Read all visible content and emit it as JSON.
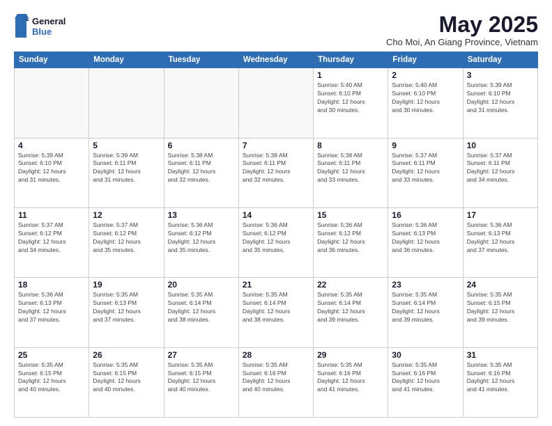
{
  "logo": {
    "line1": "General",
    "line2": "Blue"
  },
  "title": "May 2025",
  "subtitle": "Cho Moi, An Giang Province, Vietnam",
  "weekdays": [
    "Sunday",
    "Monday",
    "Tuesday",
    "Wednesday",
    "Thursday",
    "Friday",
    "Saturday"
  ],
  "weeks": [
    [
      {
        "day": "",
        "info": []
      },
      {
        "day": "",
        "info": []
      },
      {
        "day": "",
        "info": []
      },
      {
        "day": "",
        "info": []
      },
      {
        "day": "1",
        "info": [
          "Sunrise: 5:40 AM",
          "Sunset: 6:10 PM",
          "Daylight: 12 hours",
          "and 30 minutes."
        ]
      },
      {
        "day": "2",
        "info": [
          "Sunrise: 5:40 AM",
          "Sunset: 6:10 PM",
          "Daylight: 12 hours",
          "and 30 minutes."
        ]
      },
      {
        "day": "3",
        "info": [
          "Sunrise: 5:39 AM",
          "Sunset: 6:10 PM",
          "Daylight: 12 hours",
          "and 31 minutes."
        ]
      }
    ],
    [
      {
        "day": "4",
        "info": [
          "Sunrise: 5:39 AM",
          "Sunset: 6:10 PM",
          "Daylight: 12 hours",
          "and 31 minutes."
        ]
      },
      {
        "day": "5",
        "info": [
          "Sunrise: 5:39 AM",
          "Sunset: 6:11 PM",
          "Daylight: 12 hours",
          "and 31 minutes."
        ]
      },
      {
        "day": "6",
        "info": [
          "Sunrise: 5:38 AM",
          "Sunset: 6:11 PM",
          "Daylight: 12 hours",
          "and 32 minutes."
        ]
      },
      {
        "day": "7",
        "info": [
          "Sunrise: 5:38 AM",
          "Sunset: 6:11 PM",
          "Daylight: 12 hours",
          "and 32 minutes."
        ]
      },
      {
        "day": "8",
        "info": [
          "Sunrise: 5:38 AM",
          "Sunset: 6:11 PM",
          "Daylight: 12 hours",
          "and 33 minutes."
        ]
      },
      {
        "day": "9",
        "info": [
          "Sunrise: 5:37 AM",
          "Sunset: 6:11 PM",
          "Daylight: 12 hours",
          "and 33 minutes."
        ]
      },
      {
        "day": "10",
        "info": [
          "Sunrise: 5:37 AM",
          "Sunset: 6:11 PM",
          "Daylight: 12 hours",
          "and 34 minutes."
        ]
      }
    ],
    [
      {
        "day": "11",
        "info": [
          "Sunrise: 5:37 AM",
          "Sunset: 6:12 PM",
          "Daylight: 12 hours",
          "and 34 minutes."
        ]
      },
      {
        "day": "12",
        "info": [
          "Sunrise: 5:37 AM",
          "Sunset: 6:12 PM",
          "Daylight: 12 hours",
          "and 35 minutes."
        ]
      },
      {
        "day": "13",
        "info": [
          "Sunrise: 5:36 AM",
          "Sunset: 6:12 PM",
          "Daylight: 12 hours",
          "and 35 minutes."
        ]
      },
      {
        "day": "14",
        "info": [
          "Sunrise: 5:36 AM",
          "Sunset: 6:12 PM",
          "Daylight: 12 hours",
          "and 35 minutes."
        ]
      },
      {
        "day": "15",
        "info": [
          "Sunrise: 5:36 AM",
          "Sunset: 6:12 PM",
          "Daylight: 12 hours",
          "and 36 minutes."
        ]
      },
      {
        "day": "16",
        "info": [
          "Sunrise: 5:36 AM",
          "Sunset: 6:13 PM",
          "Daylight: 12 hours",
          "and 36 minutes."
        ]
      },
      {
        "day": "17",
        "info": [
          "Sunrise: 5:36 AM",
          "Sunset: 6:13 PM",
          "Daylight: 12 hours",
          "and 37 minutes."
        ]
      }
    ],
    [
      {
        "day": "18",
        "info": [
          "Sunrise: 5:36 AM",
          "Sunset: 6:13 PM",
          "Daylight: 12 hours",
          "and 37 minutes."
        ]
      },
      {
        "day": "19",
        "info": [
          "Sunrise: 5:35 AM",
          "Sunset: 6:13 PM",
          "Daylight: 12 hours",
          "and 37 minutes."
        ]
      },
      {
        "day": "20",
        "info": [
          "Sunrise: 5:35 AM",
          "Sunset: 6:14 PM",
          "Daylight: 12 hours",
          "and 38 minutes."
        ]
      },
      {
        "day": "21",
        "info": [
          "Sunrise: 5:35 AM",
          "Sunset: 6:14 PM",
          "Daylight: 12 hours",
          "and 38 minutes."
        ]
      },
      {
        "day": "22",
        "info": [
          "Sunrise: 5:35 AM",
          "Sunset: 6:14 PM",
          "Daylight: 12 hours",
          "and 39 minutes."
        ]
      },
      {
        "day": "23",
        "info": [
          "Sunrise: 5:35 AM",
          "Sunset: 6:14 PM",
          "Daylight: 12 hours",
          "and 39 minutes."
        ]
      },
      {
        "day": "24",
        "info": [
          "Sunrise: 5:35 AM",
          "Sunset: 6:15 PM",
          "Daylight: 12 hours",
          "and 39 minutes."
        ]
      }
    ],
    [
      {
        "day": "25",
        "info": [
          "Sunrise: 5:35 AM",
          "Sunset: 6:15 PM",
          "Daylight: 12 hours",
          "and 40 minutes."
        ]
      },
      {
        "day": "26",
        "info": [
          "Sunrise: 5:35 AM",
          "Sunset: 6:15 PM",
          "Daylight: 12 hours",
          "and 40 minutes."
        ]
      },
      {
        "day": "27",
        "info": [
          "Sunrise: 5:35 AM",
          "Sunset: 6:15 PM",
          "Daylight: 12 hours",
          "and 40 minutes."
        ]
      },
      {
        "day": "28",
        "info": [
          "Sunrise: 5:35 AM",
          "Sunset: 6:16 PM",
          "Daylight: 12 hours",
          "and 40 minutes."
        ]
      },
      {
        "day": "29",
        "info": [
          "Sunrise: 5:35 AM",
          "Sunset: 6:16 PM",
          "Daylight: 12 hours",
          "and 41 minutes."
        ]
      },
      {
        "day": "30",
        "info": [
          "Sunrise: 5:35 AM",
          "Sunset: 6:16 PM",
          "Daylight: 12 hours",
          "and 41 minutes."
        ]
      },
      {
        "day": "31",
        "info": [
          "Sunrise: 5:35 AM",
          "Sunset: 6:16 PM",
          "Daylight: 12 hours",
          "and 41 minutes."
        ]
      }
    ]
  ]
}
